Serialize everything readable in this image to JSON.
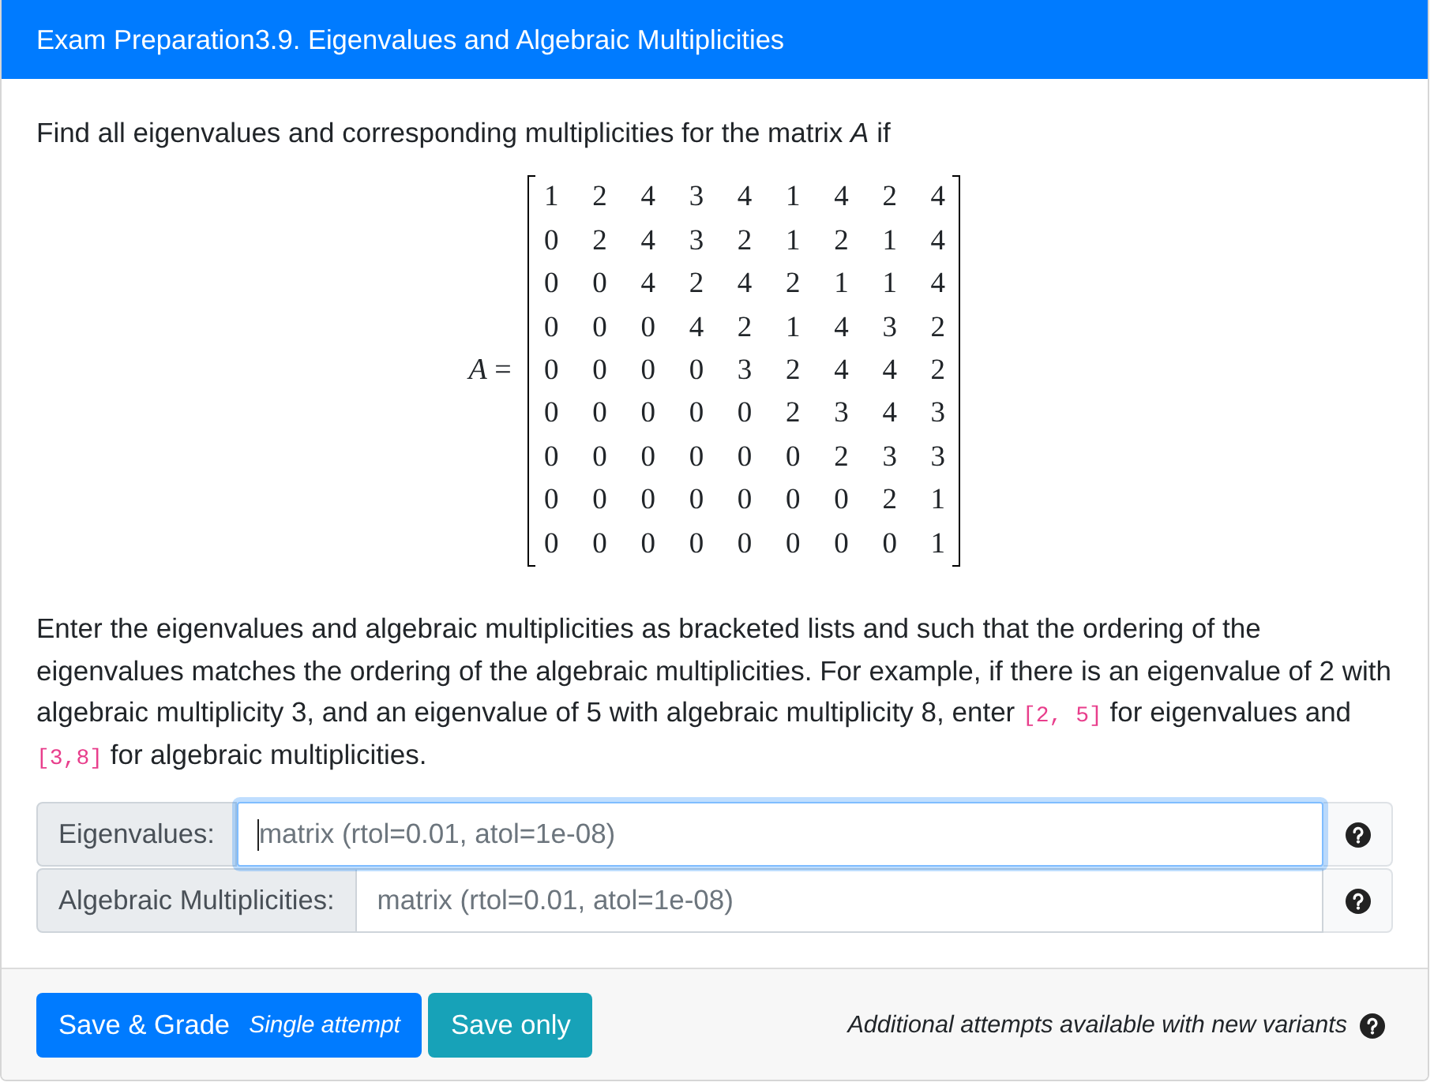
{
  "header": {
    "title": "Exam Preparation3.9. Eigenvalues and Algebraic Multiplicities"
  },
  "prompt": "Find all eigenvalues and corresponding multiplicities for the matrix *A* if",
  "matrix": {
    "lhs": "*A* =",
    "rows": [
      [
        "1",
        "2",
        "4",
        "3",
        "4",
        "1",
        "4",
        "2",
        "4"
      ],
      [
        "0",
        "2",
        "4",
        "3",
        "2",
        "1",
        "2",
        "1",
        "4"
      ],
      [
        "0",
        "0",
        "4",
        "2",
        "4",
        "2",
        "1",
        "1",
        "4"
      ],
      [
        "0",
        "0",
        "0",
        "4",
        "2",
        "1",
        "4",
        "3",
        "2"
      ],
      [
        "0",
        "0",
        "0",
        "0",
        "3",
        "2",
        "4",
        "4",
        "2"
      ],
      [
        "0",
        "0",
        "0",
        "0",
        "0",
        "2",
        "3",
        "4",
        "3"
      ],
      [
        "0",
        "0",
        "0",
        "0",
        "0",
        "0",
        "2",
        "3",
        "3"
      ],
      [
        "0",
        "0",
        "0",
        "0",
        "0",
        "0",
        "0",
        "2",
        "1"
      ],
      [
        "0",
        "0",
        "0",
        "0",
        "0",
        "0",
        "0",
        "0",
        "1"
      ]
    ]
  },
  "instructions": [
    {
      "kind": "text",
      "text": "Enter the eigenvalues and algebraic multiplicities as bracketed lists and such that the ordering of the eigenvalues matches the ordering of the algebraic multiplicities. For example, if there is an eigenvalue of 2 with algebraic multiplicity 3, and an eigenvalue of 5 with algebraic multiplicity 8, enter "
    },
    {
      "kind": "code",
      "text": "[2, 5]"
    },
    {
      "kind": "text",
      "text": " for eigenvalues and "
    },
    {
      "kind": "code",
      "text": "[3,8]"
    },
    {
      "kind": "text",
      "text": " for algebraic multiplicities."
    }
  ],
  "fields": [
    {
      "label": "Eigenvalues:",
      "placeholder": "matrix (rtol=0.01, atol=1e-08)",
      "focused": true
    },
    {
      "label": "Algebraic Multiplicities:",
      "placeholder": "matrix (rtol=0.01, atol=1e-08)",
      "focused": false
    }
  ],
  "footer": {
    "buttons": [
      {
        "kind": "primary",
        "label": "Save & Grade",
        "note": "Single attempt"
      },
      {
        "kind": "secondary",
        "label": "Save only"
      }
    ],
    "note": "Additional attempts available with new variants"
  }
}
